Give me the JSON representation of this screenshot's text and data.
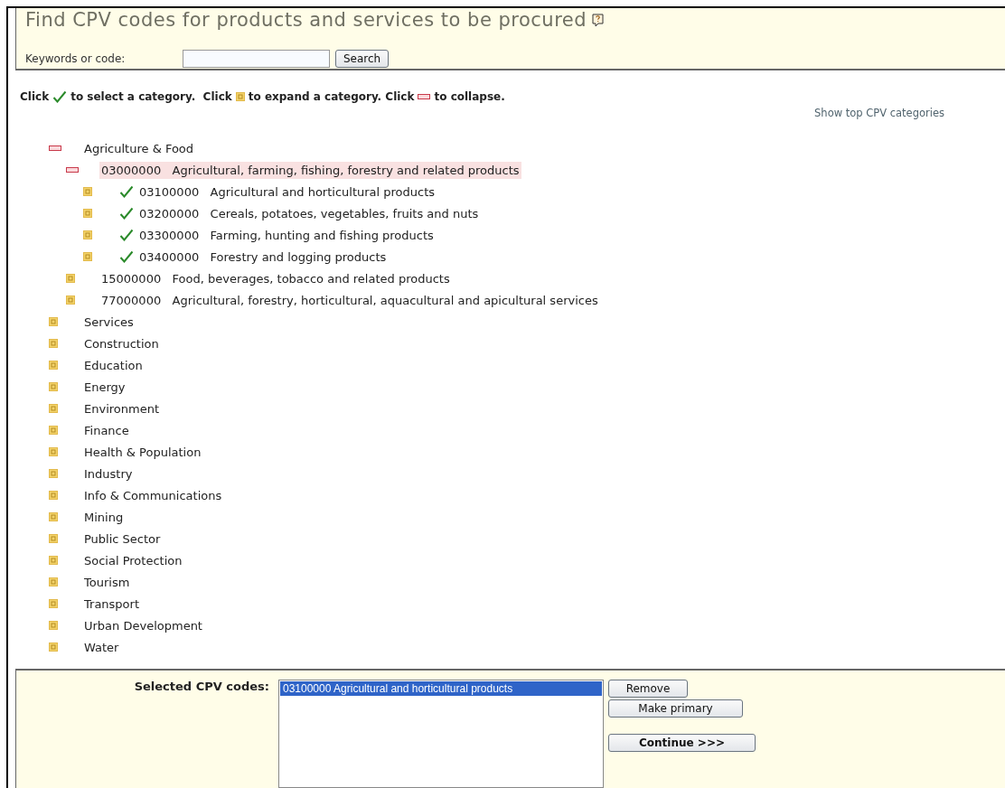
{
  "header": {
    "title": "Find CPV codes for products and services to be procured",
    "search_label": "Keywords or code:",
    "search_button": "Search"
  },
  "instructions": [
    "Click",
    "to select a category.  Click",
    "to expand a category. Click",
    "to collapse."
  ],
  "top_link": "Show top CPV categories",
  "tree": [
    {
      "label": "Agriculture & Food",
      "expanded": true,
      "selected": false,
      "checkable": false,
      "children": [
        {
          "code": "03000000",
          "label": "Agricultural, farming, fishing, forestry and related products",
          "expanded": true,
          "selected": true,
          "checkable": false,
          "children": [
            {
              "code": "03100000",
              "label": "Agricultural and horticultural products",
              "expanded": false,
              "selected": false,
              "checkable": true
            },
            {
              "code": "03200000",
              "label": "Cereals, potatoes, vegetables, fruits and nuts",
              "expanded": false,
              "selected": false,
              "checkable": true
            },
            {
              "code": "03300000",
              "label": "Farming, hunting and fishing products",
              "expanded": false,
              "selected": false,
              "checkable": true
            },
            {
              "code": "03400000",
              "label": "Forestry and logging products",
              "expanded": false,
              "selected": false,
              "checkable": true
            }
          ]
        },
        {
          "code": "15000000",
          "label": "Food, beverages, tobacco and related products",
          "expanded": false,
          "selected": false,
          "checkable": false
        },
        {
          "code": "77000000",
          "label": "Agricultural, forestry, horticultural, aquacultural and apicultural services",
          "expanded": false,
          "selected": false,
          "checkable": false
        }
      ]
    },
    {
      "label": "Services",
      "expanded": false,
      "selected": false,
      "checkable": false
    },
    {
      "label": "Construction",
      "expanded": false,
      "selected": false,
      "checkable": false
    },
    {
      "label": "Education",
      "expanded": false,
      "selected": false,
      "checkable": false
    },
    {
      "label": "Energy",
      "expanded": false,
      "selected": false,
      "checkable": false
    },
    {
      "label": "Environment",
      "expanded": false,
      "selected": false,
      "checkable": false
    },
    {
      "label": "Finance",
      "expanded": false,
      "selected": false,
      "checkable": false
    },
    {
      "label": "Health & Population",
      "expanded": false,
      "selected": false,
      "checkable": false
    },
    {
      "label": "Industry",
      "expanded": false,
      "selected": false,
      "checkable": false
    },
    {
      "label": "Info & Communications",
      "expanded": false,
      "selected": false,
      "checkable": false
    },
    {
      "label": "Mining",
      "expanded": false,
      "selected": false,
      "checkable": false
    },
    {
      "label": "Public Sector",
      "expanded": false,
      "selected": false,
      "checkable": false
    },
    {
      "label": "Social Protection",
      "expanded": false,
      "selected": false,
      "checkable": false
    },
    {
      "label": "Tourism",
      "expanded": false,
      "selected": false,
      "checkable": false
    },
    {
      "label": "Transport",
      "expanded": false,
      "selected": false,
      "checkable": false
    },
    {
      "label": "Urban Development",
      "expanded": false,
      "selected": false,
      "checkable": false
    },
    {
      "label": "Water",
      "expanded": false,
      "selected": false,
      "checkable": false
    }
  ],
  "selected_panel": {
    "label": "Selected CPV codes:",
    "items": [
      {
        "text": "03100000 Agricultural and horticultural products",
        "selected": true
      }
    ],
    "buttons": [
      "Remove",
      "Make primary"
    ],
    "continue_button": "Continue >>>"
  }
}
